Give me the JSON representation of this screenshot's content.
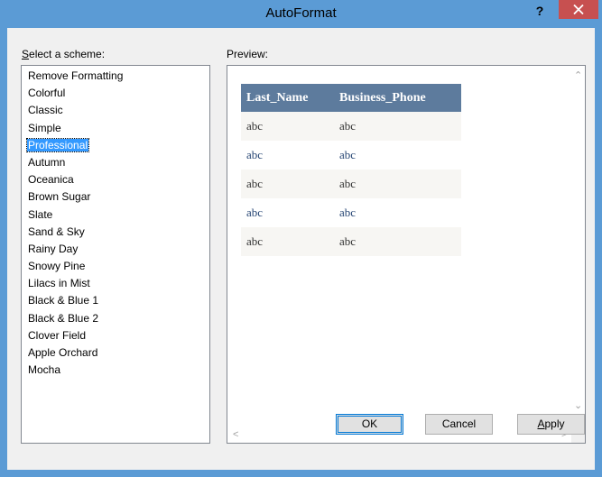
{
  "window": {
    "title": "AutoFormat",
    "help_label": "?"
  },
  "scheme": {
    "label": "Select a scheme:",
    "selected": "Professional",
    "items": [
      "Remove Formatting",
      "Colorful",
      "Classic",
      "Simple",
      "Professional",
      "Autumn",
      "Oceanica",
      "Brown Sugar",
      "Slate",
      "Sand & Sky",
      "Rainy Day",
      "Snowy Pine",
      "Lilacs in Mist",
      "Black & Blue 1",
      "Black & Blue 2",
      "Clover Field",
      "Apple Orchard",
      "Mocha"
    ]
  },
  "preview": {
    "label": "Preview:",
    "columns": [
      "Last_Name",
      "Business_Phone"
    ],
    "rows": [
      [
        "abc",
        "abc"
      ],
      [
        "abc",
        "abc"
      ],
      [
        "abc",
        "abc"
      ],
      [
        "abc",
        "abc"
      ],
      [
        "abc",
        "abc"
      ]
    ]
  },
  "buttons": {
    "ok": "OK",
    "cancel": "Cancel",
    "apply": "Apply"
  },
  "colors": {
    "titlebar": "#5b9bd5",
    "close": "#c75050",
    "header": "#5d7b9d",
    "row_alt": "#f7f6f3",
    "link_text": "#284775",
    "selection": "#3399ff"
  }
}
